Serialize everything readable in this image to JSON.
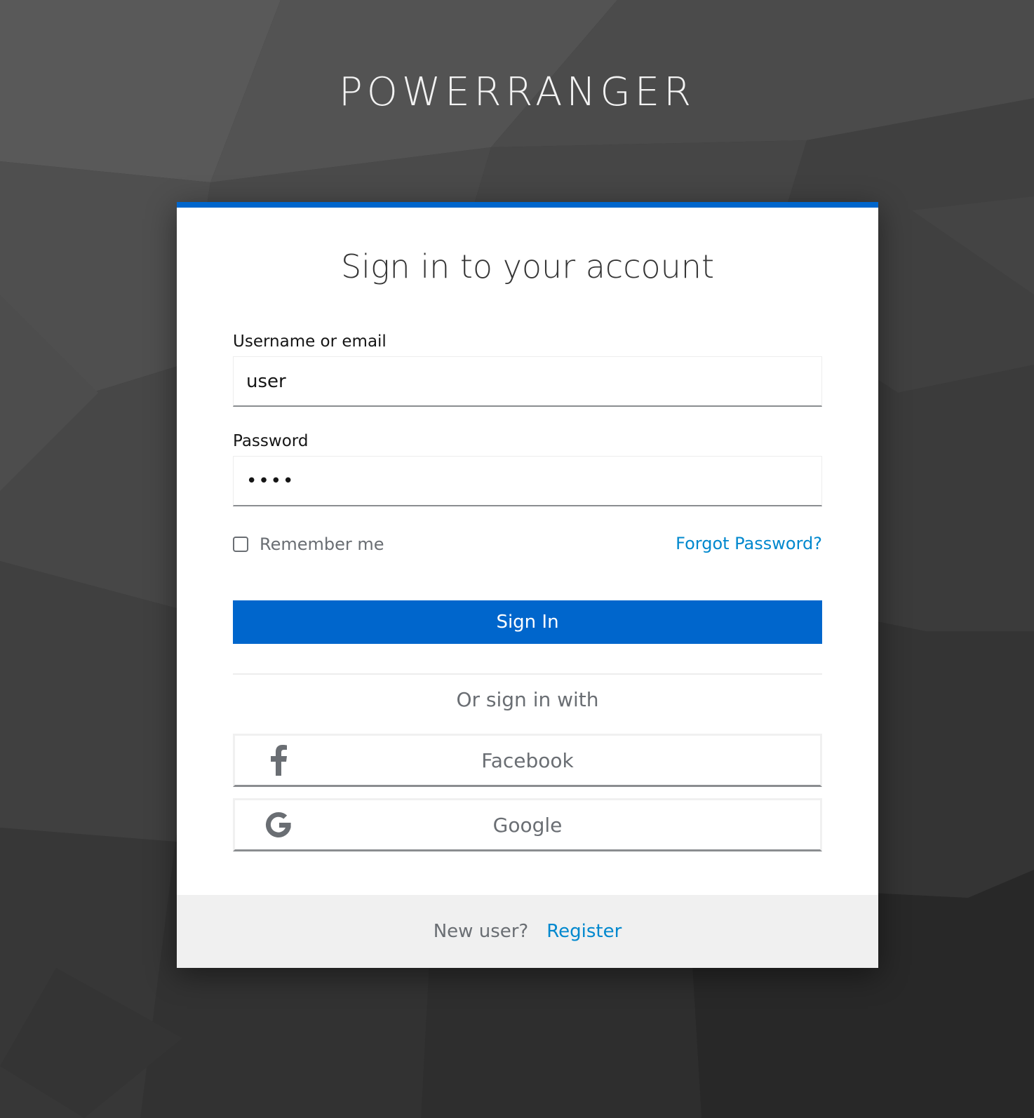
{
  "brand": {
    "title": "POWERRANGER"
  },
  "login": {
    "title": "Sign in to your account",
    "username": {
      "label": "Username or email",
      "value": "user"
    },
    "password": {
      "label": "Password",
      "value": "••••"
    },
    "remember_me": {
      "label": "Remember me",
      "checked": false
    },
    "forgot_password": "Forgot Password?",
    "submit_label": "Sign In",
    "social_heading": "Or sign in with",
    "social_providers": [
      {
        "label": "Facebook",
        "icon": "facebook-icon"
      },
      {
        "label": "Google",
        "icon": "google-icon"
      }
    ]
  },
  "footer": {
    "new_user_text": "New user?",
    "register_label": "Register"
  },
  "colors": {
    "accent": "#0066cc",
    "link": "#0088ce",
    "background": "#3a3a3a"
  }
}
